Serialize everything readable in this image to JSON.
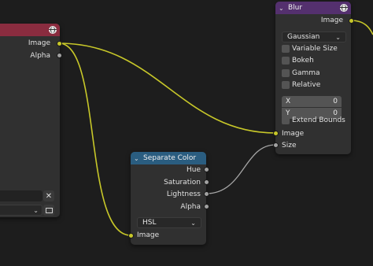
{
  "nodes": {
    "left": {
      "outputs": [
        "Image",
        "Alpha"
      ]
    },
    "blur": {
      "title": "Blur",
      "output": "Image",
      "filter_type": "Gaussian",
      "checkboxes": [
        "Variable Size",
        "Bokeh",
        "Gamma",
        "Relative"
      ],
      "size_x_label": "X",
      "size_x_value": "0",
      "size_y_label": "Y",
      "size_y_value": "0",
      "extend_bounds": "Extend Bounds",
      "inputs": [
        "Image",
        "Size"
      ]
    },
    "separate_color": {
      "title": "Separate Color",
      "outputs": [
        "Hue",
        "Saturation",
        "Lightness",
        "Alpha"
      ],
      "mode": "HSL",
      "input": "Image"
    }
  },
  "colors": {
    "image_socket": "#c7c729",
    "float_socket": "#a1a1a1",
    "blur_header": "#54306e",
    "separate_header": "#2a5d80",
    "left_header": "#8a2c3f",
    "background": "#1d1d1d"
  },
  "icons": {
    "collapse": "chevron-down-icon",
    "preview": "globe-icon",
    "clear": "close-icon",
    "browse": "image-icon"
  }
}
